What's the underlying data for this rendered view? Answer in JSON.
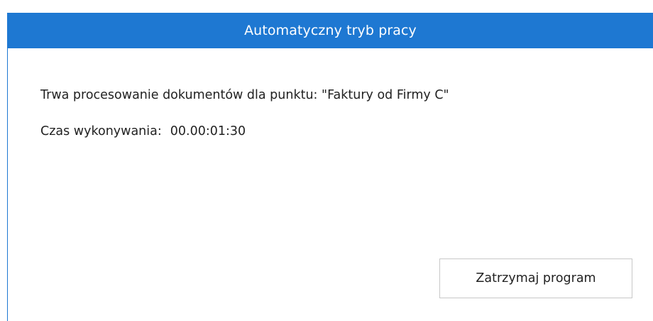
{
  "window": {
    "title": "Automatyczny tryb pracy"
  },
  "status": {
    "processing_text": "Trwa procesowanie dokumentów dla punktu: \"Faktury od Firmy C\"",
    "elapsed_label": "Czas wykonywania:",
    "elapsed_value": "00.00:01:30"
  },
  "actions": {
    "stop_label": "Zatrzymaj program"
  },
  "colors": {
    "titlebar": "#1e78d2",
    "title_text": "#ffffff"
  }
}
